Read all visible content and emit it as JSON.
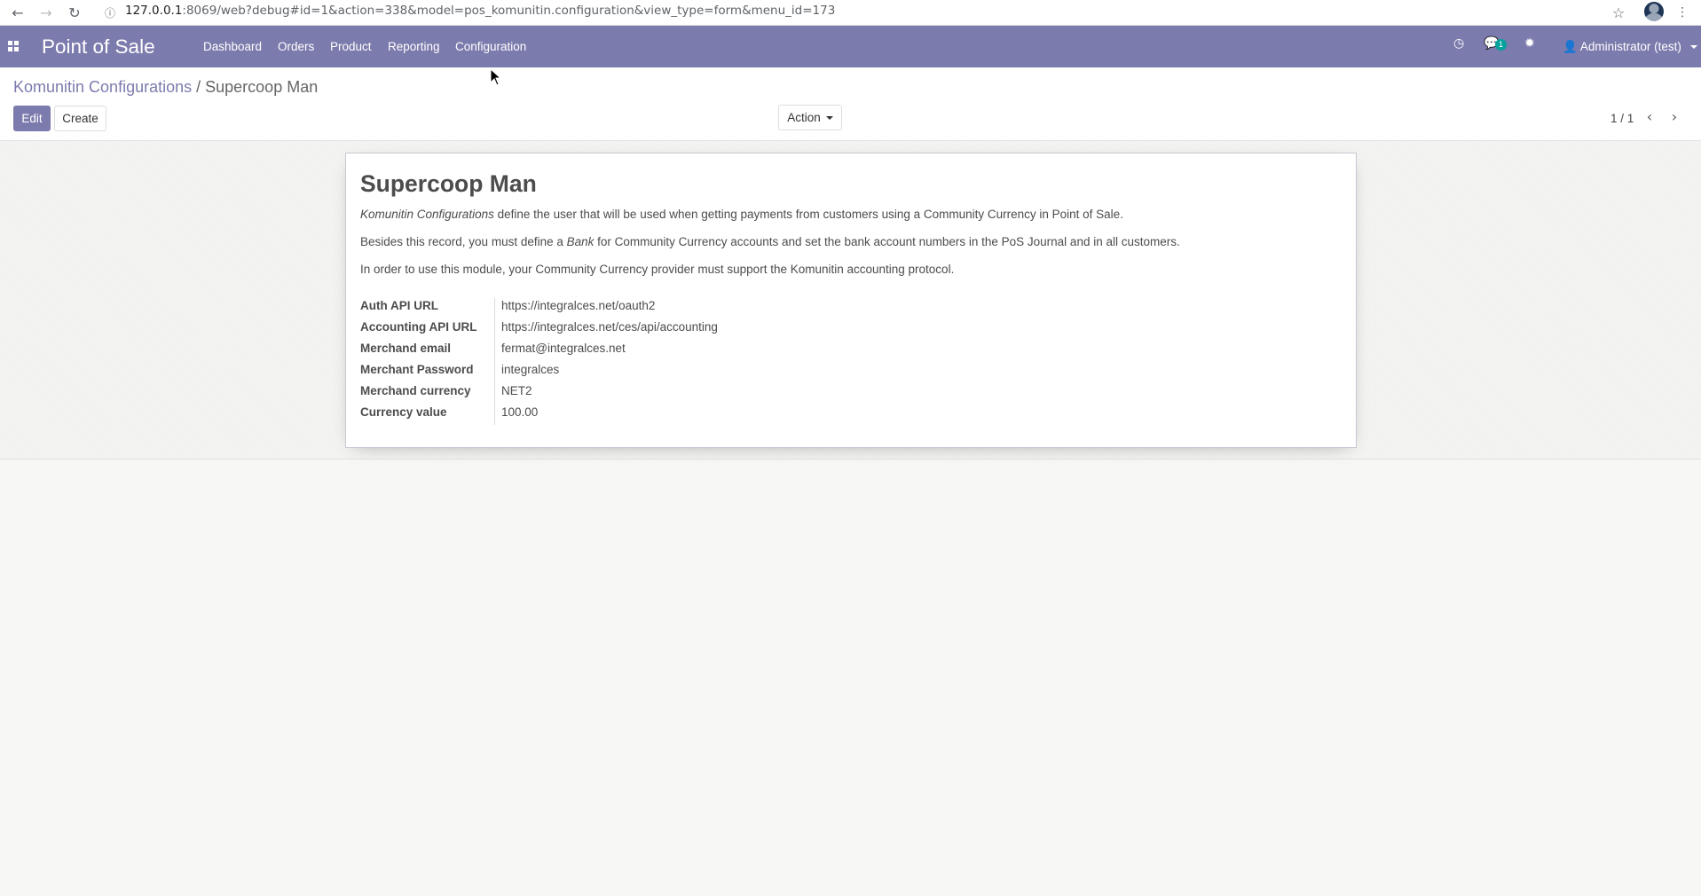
{
  "browser": {
    "url_host": "127.0.0.1",
    "url_rest": ":8069/web?debug#id=1&action=338&model=pos_komunitin.configuration&view_type=form&menu_id=173"
  },
  "navbar": {
    "brand": "Point of Sale",
    "menu": [
      "Dashboard",
      "Orders",
      "Product",
      "Reporting",
      "Configuration"
    ],
    "chat_count": "1",
    "user": "Administrator (test)"
  },
  "breadcrumb": {
    "parent": "Komunitin Configurations",
    "separator": "/",
    "current": "Supercoop Man"
  },
  "toolbar": {
    "edit_label": "Edit",
    "create_label": "Create",
    "action_label": "Action"
  },
  "pager": {
    "value": "1 / 1"
  },
  "form": {
    "title": "Supercoop Man",
    "p1_em": "Komunitin Configurations",
    "p1_rest": " define the user that will be used when getting payments from customers using a Community Currency in Point of Sale.",
    "p2_a": "Besides this record, you must define a ",
    "p2_em": "Bank",
    "p2_b": " for Community Currency accounts and set the bank account numbers in the PoS Journal and in all customers.",
    "p3": "In order to use this module, your Community Currency provider must support the Komunitin accounting protocol.",
    "fields": [
      {
        "label": "Auth API URL",
        "value": "https://integralces.net/oauth2"
      },
      {
        "label": "Accounting API URL",
        "value": "https://integralces.net/ces/api/accounting"
      },
      {
        "label": "Merchand email",
        "value": "fermat@integralces.net"
      },
      {
        "label": "Merchant Password",
        "value": "integralces"
      },
      {
        "label": "Merchand currency",
        "value": "NET2"
      },
      {
        "label": "Currency value",
        "value": "100.00"
      }
    ]
  },
  "colors": {
    "brand": "#7c7bad",
    "badge": "#00a09d"
  }
}
